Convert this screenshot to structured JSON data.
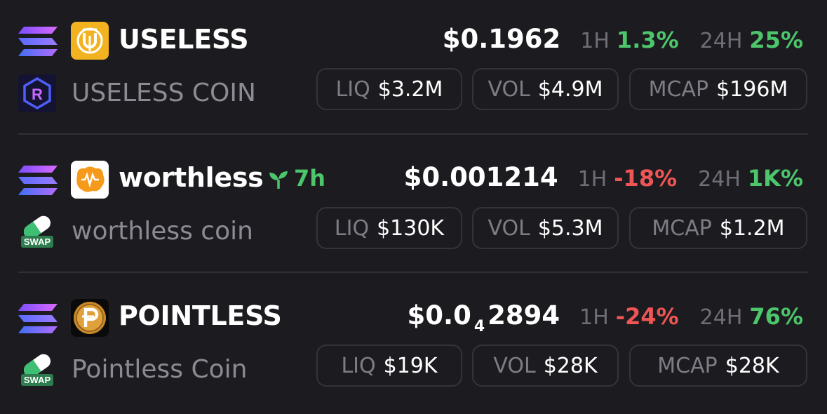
{
  "colors": {
    "background": "#1c1c20",
    "positive": "#4cc56b",
    "negative": "#ee5555",
    "muted": "#8b8b93",
    "border": "#333339"
  },
  "tokens": [
    {
      "chain_icon": "solana-icon",
      "logo_icon": "useless-logo-icon",
      "dex_icon": "raydium-icon",
      "symbol": "USELESS",
      "age": "",
      "name": "USELESS COIN",
      "price_prefix": "$0.1962",
      "price_subscript": "",
      "price_suffix": "",
      "h1_label": "1H",
      "h1_change": "1.3%",
      "h1_direction": "up",
      "h24_label": "24H",
      "h24_change": "25%",
      "h24_direction": "up",
      "liq_label": "LIQ",
      "liq_value": "$3.2M",
      "vol_label": "VOL",
      "vol_value": "$4.9M",
      "mcap_label": "MCAP",
      "mcap_value": "$196M"
    },
    {
      "chain_icon": "solana-icon",
      "logo_icon": "worthless-logo-icon",
      "dex_icon": "pump-swap-icon",
      "symbol": "worthless",
      "age": "7h",
      "age_icon": "sprout-icon",
      "name": "worthless coin",
      "price_prefix": "$0.001214",
      "price_subscript": "",
      "price_suffix": "",
      "h1_label": "1H",
      "h1_change": "-18%",
      "h1_direction": "down",
      "h24_label": "24H",
      "h24_change": "1K%",
      "h24_direction": "up",
      "liq_label": "LIQ",
      "liq_value": "$130K",
      "vol_label": "VOL",
      "vol_value": "$5.3M",
      "mcap_label": "MCAP",
      "mcap_value": "$1.2M"
    },
    {
      "chain_icon": "solana-icon",
      "logo_icon": "pointless-logo-icon",
      "dex_icon": "pump-swap-icon",
      "symbol": "POINTLESS",
      "age": "",
      "name": "Pointless Coin",
      "price_prefix": "$0.0",
      "price_subscript": "4",
      "price_suffix": "2894",
      "h1_label": "1H",
      "h1_change": "-24%",
      "h1_direction": "down",
      "h24_label": "24H",
      "h24_change": "76%",
      "h24_direction": "up",
      "liq_label": "LIQ",
      "liq_value": "$19K",
      "vol_label": "VOL",
      "vol_value": "$28K",
      "mcap_label": "MCAP",
      "mcap_value": "$28K"
    }
  ],
  "dex_badge_text": "SWAP"
}
